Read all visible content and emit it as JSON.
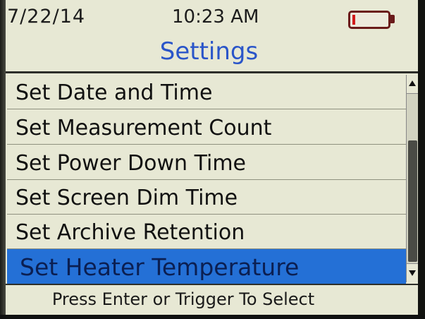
{
  "status": {
    "date": "7/22/14",
    "time": "10:23 AM",
    "battery_icon": "battery-low-icon",
    "battery_level_percent": 5
  },
  "title": "Settings",
  "menu": {
    "items": [
      {
        "label": "Set Date and Time",
        "selected": false
      },
      {
        "label": "Set Measurement Count",
        "selected": false
      },
      {
        "label": "Set Power Down Time",
        "selected": false
      },
      {
        "label": "Set Screen Dim Time",
        "selected": false
      },
      {
        "label": "Set Archive Retention",
        "selected": false
      },
      {
        "label": "Set Heater Temperature",
        "selected": true
      }
    ]
  },
  "scrollbar": {
    "up_icon": "arrow-up-icon",
    "down_icon": "arrow-down-icon"
  },
  "footer": "Press Enter or Trigger To Select",
  "colors": {
    "title": "#2a55c9",
    "selection": "#2470d6",
    "background": "#e7e8d4",
    "battery": "#d11a1a"
  }
}
